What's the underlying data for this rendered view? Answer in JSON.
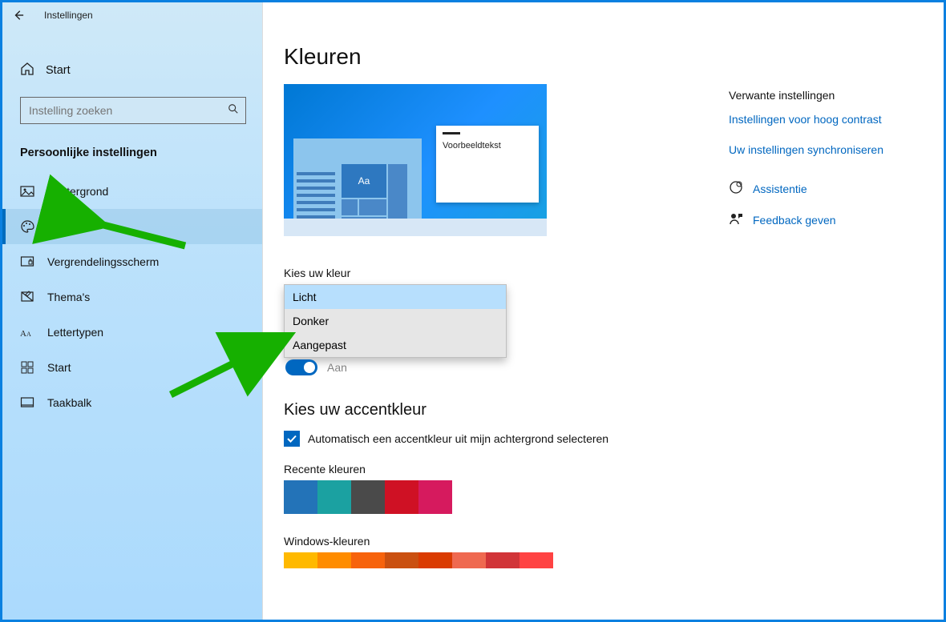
{
  "window": {
    "title": "Instellingen"
  },
  "sidebar": {
    "home_label": "Start",
    "search_placeholder": "Instelling zoeken",
    "heading": "Persoonlijke instellingen",
    "items": [
      {
        "label": "Achtergrond"
      },
      {
        "label": "Kleuren"
      },
      {
        "label": "Vergrendelingsscherm"
      },
      {
        "label": "Thema's"
      },
      {
        "label": "Lettertypen"
      },
      {
        "label": "Start"
      },
      {
        "label": "Taakbalk"
      }
    ],
    "selected_index": 1
  },
  "main": {
    "title": "Kleuren",
    "preview_text": "Voorbeeldtekst",
    "preview_tile_text": "Aa",
    "pick_color_label": "Kies uw kleur",
    "color_options": [
      "Licht",
      "Donker",
      "Aangepast"
    ],
    "color_selected_index": 0,
    "toggle_text": "Aan",
    "accent_heading": "Kies uw accentkleur",
    "auto_accent_checkbox": "Automatisch een accentkleur uit mijn achtergrond selecteren",
    "auto_accent_checked": true,
    "recent_label": "Recente kleuren",
    "recent_colors": [
      "#2373B8",
      "#1BA1A1",
      "#4A4A4A",
      "#CF1124",
      "#D61A5E"
    ],
    "windows_label": "Windows-kleuren",
    "windows_colors": [
      "#FFB900",
      "#FF8C00",
      "#F7630C",
      "#CA5010",
      "#DA3B01",
      "#EF6950",
      "#D13438",
      "#FF4343"
    ]
  },
  "aside": {
    "heading": "Verwante instellingen",
    "links": [
      "Instellingen voor hoog contrast",
      "Uw instellingen synchroniseren"
    ],
    "icon_links": [
      "Assistentie",
      "Feedback geven"
    ]
  }
}
